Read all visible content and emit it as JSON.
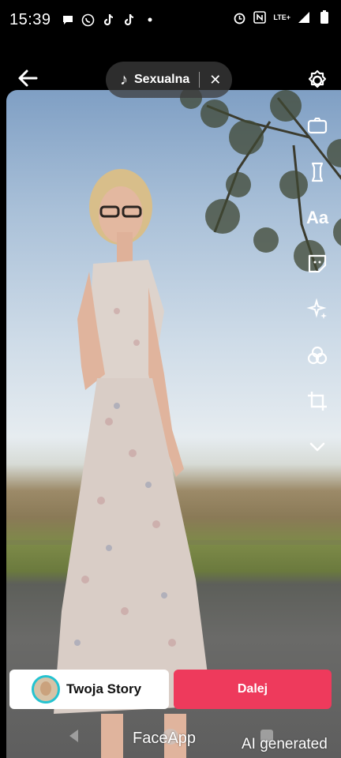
{
  "status_bar": {
    "time": "15:39",
    "left_icons": [
      "chat-bubble-icon",
      "whatsapp-icon",
      "tiktok-icon",
      "tiktok-icon",
      "dot-icon"
    ],
    "right_icons": [
      "alarm-icon",
      "nfc-icon",
      "lte-signal-icon",
      "battery-icon"
    ],
    "network_label": "LTE+"
  },
  "top_bar": {
    "back_icon": "back-arrow-icon",
    "sound_title": "Sexualna",
    "sound_icon": "music-note-icon",
    "sound_close": "✕",
    "settings_icon": "gear-icon"
  },
  "tools": [
    {
      "name": "flip-icon"
    },
    {
      "name": "timer-icon"
    },
    {
      "name": "text-icon",
      "label": "Aa"
    },
    {
      "name": "sticker-icon"
    },
    {
      "name": "effects-icon"
    },
    {
      "name": "filters-icon"
    },
    {
      "name": "crop-icon"
    },
    {
      "name": "more-chevron-icon"
    }
  ],
  "bottom": {
    "story_label": "Twoja Story",
    "next_label": "Dalej"
  },
  "watermarks": {
    "faceapp": "FaceApp",
    "ai": "AI generated"
  },
  "colors": {
    "accent": "#ee3a5c",
    "story_ring": "#25c3d0"
  }
}
